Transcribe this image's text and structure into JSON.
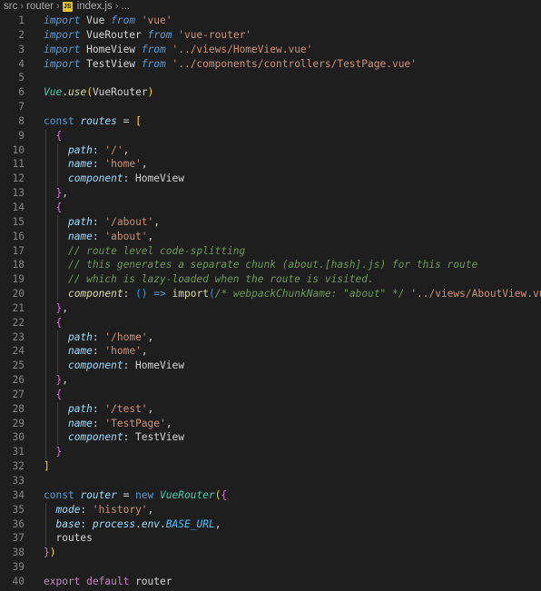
{
  "breadcrumb": {
    "items": [
      "src",
      "router"
    ],
    "file_icon_label": "JS",
    "file": "index.js",
    "ellipsis": "..."
  },
  "colors": {
    "background": "#1e1e1e",
    "keyword": "#569cd6",
    "control_keyword": "#c586c0",
    "string": "#ce9178",
    "variable": "#9cdcfe",
    "function": "#dcdcaa",
    "class": "#4ec9b0",
    "comment": "#6a9955",
    "line_number": "#858585",
    "bracket_level1": "#ffd700",
    "bracket_level2": "#da70d6",
    "bracket_level3": "#179fff"
  },
  "line_numbers": [
    "1",
    "2",
    "3",
    "4",
    "5",
    "6",
    "7",
    "8",
    "9",
    "10",
    "11",
    "12",
    "13",
    "14",
    "15",
    "16",
    "17",
    "18",
    "19",
    "20",
    "21",
    "22",
    "23",
    "24",
    "25",
    "26",
    "27",
    "28",
    "29",
    "30",
    "31",
    "32",
    "33",
    "34",
    "35",
    "36",
    "37",
    "38",
    "39",
    "40"
  ],
  "code_lines": [
    [
      [
        "kwf",
        "import"
      ],
      [
        "pl",
        " Vue "
      ],
      [
        "kwf",
        "from"
      ],
      [
        "pl",
        " "
      ],
      [
        "str",
        "'vue'"
      ]
    ],
    [
      [
        "kwf",
        "import"
      ],
      [
        "pl",
        " VueRouter "
      ],
      [
        "kwf",
        "from"
      ],
      [
        "pl",
        " "
      ],
      [
        "str",
        "'vue-router'"
      ]
    ],
    [
      [
        "kwf",
        "import"
      ],
      [
        "pl",
        " HomeView "
      ],
      [
        "kwf",
        "from"
      ],
      [
        "pl",
        " "
      ],
      [
        "str",
        "'../views/HomeView.vue'"
      ]
    ],
    [
      [
        "kwf",
        "import"
      ],
      [
        "pl",
        " TestView "
      ],
      [
        "kwf",
        "from"
      ],
      [
        "pl",
        " "
      ],
      [
        "str",
        "'../components/controllers/TestPage.vue'"
      ]
    ],
    [],
    [
      [
        "clsi",
        "Vue"
      ],
      [
        "pl",
        "."
      ],
      [
        "fni",
        "use"
      ],
      [
        "br1",
        "("
      ],
      [
        "pl",
        "VueRouter"
      ],
      [
        "br1",
        ")"
      ]
    ],
    [],
    [
      [
        "kw",
        "const"
      ],
      [
        "pl",
        " "
      ],
      [
        "prop",
        "routes"
      ],
      [
        "pl",
        " = "
      ],
      [
        "br1",
        "["
      ]
    ],
    [
      [
        "pl",
        "  "
      ],
      [
        "br2",
        "{"
      ]
    ],
    [
      [
        "pl",
        "    "
      ],
      [
        "prop",
        "path"
      ],
      [
        "pl",
        ": "
      ],
      [
        "str",
        "'/'"
      ],
      [
        "pl",
        ","
      ]
    ],
    [
      [
        "pl",
        "    "
      ],
      [
        "prop",
        "name"
      ],
      [
        "pl",
        ": "
      ],
      [
        "str",
        "'home'"
      ],
      [
        "pl",
        ","
      ]
    ],
    [
      [
        "pl",
        "    "
      ],
      [
        "prop",
        "component"
      ],
      [
        "pl",
        ": HomeView"
      ]
    ],
    [
      [
        "pl",
        "  "
      ],
      [
        "br2",
        "}"
      ],
      [
        "pl",
        ","
      ]
    ],
    [
      [
        "pl",
        "  "
      ],
      [
        "br2",
        "{"
      ]
    ],
    [
      [
        "pl",
        "    "
      ],
      [
        "prop",
        "path"
      ],
      [
        "pl",
        ": "
      ],
      [
        "str",
        "'/about'"
      ],
      [
        "pl",
        ","
      ]
    ],
    [
      [
        "pl",
        "    "
      ],
      [
        "prop",
        "name"
      ],
      [
        "pl",
        ": "
      ],
      [
        "str",
        "'about'"
      ],
      [
        "pl",
        ","
      ]
    ],
    [
      [
        "pl",
        "    "
      ],
      [
        "com",
        "// route level code-splitting"
      ]
    ],
    [
      [
        "pl",
        "    "
      ],
      [
        "com",
        "// this generates a separate chunk (about.[hash].js) for this route"
      ]
    ],
    [
      [
        "pl",
        "    "
      ],
      [
        "com",
        "// which is lazy-loaded when the route is visited."
      ]
    ],
    [
      [
        "pl",
        "    "
      ],
      [
        "fni",
        "component"
      ],
      [
        "pl",
        ": "
      ],
      [
        "br3",
        "()"
      ],
      [
        "pl",
        " "
      ],
      [
        "kw",
        "=>"
      ],
      [
        "pl",
        " "
      ],
      [
        "fn",
        "import"
      ],
      [
        "br3",
        "("
      ],
      [
        "com",
        "/* webpackChunkName: \"about\" */"
      ],
      [
        "pl",
        " "
      ],
      [
        "str",
        "'../views/AboutView.vue'"
      ],
      [
        "br3",
        ")"
      ]
    ],
    [
      [
        "pl",
        "  "
      ],
      [
        "br2",
        "}"
      ],
      [
        "pl",
        ","
      ]
    ],
    [
      [
        "pl",
        "  "
      ],
      [
        "br2",
        "{"
      ]
    ],
    [
      [
        "pl",
        "    "
      ],
      [
        "prop",
        "path"
      ],
      [
        "pl",
        ": "
      ],
      [
        "str",
        "'/home'"
      ],
      [
        "pl",
        ","
      ]
    ],
    [
      [
        "pl",
        "    "
      ],
      [
        "prop",
        "name"
      ],
      [
        "pl",
        ": "
      ],
      [
        "str",
        "'home'"
      ],
      [
        "pl",
        ","
      ]
    ],
    [
      [
        "pl",
        "    "
      ],
      [
        "prop",
        "component"
      ],
      [
        "pl",
        ": HomeView"
      ]
    ],
    [
      [
        "pl",
        "  "
      ],
      [
        "br2",
        "}"
      ],
      [
        "pl",
        ","
      ]
    ],
    [
      [
        "pl",
        "  "
      ],
      [
        "br2",
        "{"
      ]
    ],
    [
      [
        "pl",
        "    "
      ],
      [
        "prop",
        "path"
      ],
      [
        "pl",
        ": "
      ],
      [
        "str",
        "'/test'"
      ],
      [
        "pl",
        ","
      ]
    ],
    [
      [
        "pl",
        "    "
      ],
      [
        "prop",
        "name"
      ],
      [
        "pl",
        ": "
      ],
      [
        "str",
        "'TestPage'"
      ],
      [
        "pl",
        ","
      ]
    ],
    [
      [
        "pl",
        "    "
      ],
      [
        "prop",
        "component"
      ],
      [
        "pl",
        ": TestView"
      ]
    ],
    [
      [
        "pl",
        "  "
      ],
      [
        "br2",
        "}"
      ]
    ],
    [
      [
        "br1",
        "]"
      ]
    ],
    [],
    [
      [
        "kw",
        "const"
      ],
      [
        "pl",
        " "
      ],
      [
        "prop",
        "router"
      ],
      [
        "pl",
        " = "
      ],
      [
        "kw",
        "new"
      ],
      [
        "pl",
        " "
      ],
      [
        "clsi",
        "VueRouter"
      ],
      [
        "br1",
        "("
      ],
      [
        "br2",
        "{"
      ]
    ],
    [
      [
        "pl",
        "  "
      ],
      [
        "prop",
        "mode"
      ],
      [
        "pl",
        ": "
      ],
      [
        "str",
        "'history'"
      ],
      [
        "pl",
        ","
      ]
    ],
    [
      [
        "pl",
        "  "
      ],
      [
        "prop",
        "base"
      ],
      [
        "pl",
        ": "
      ],
      [
        "prop",
        "process"
      ],
      [
        "pl",
        "."
      ],
      [
        "prop",
        "env"
      ],
      [
        "pl",
        "."
      ],
      [
        "cst",
        "BASE_URL"
      ],
      [
        "pl",
        ","
      ]
    ],
    [
      [
        "pl",
        "  routes"
      ]
    ],
    [
      [
        "br2",
        "}"
      ],
      [
        "br1",
        ")"
      ]
    ],
    [],
    [
      [
        "pur",
        "export"
      ],
      [
        "pl",
        " "
      ],
      [
        "pur",
        "default"
      ],
      [
        "pl",
        " router"
      ]
    ]
  ]
}
